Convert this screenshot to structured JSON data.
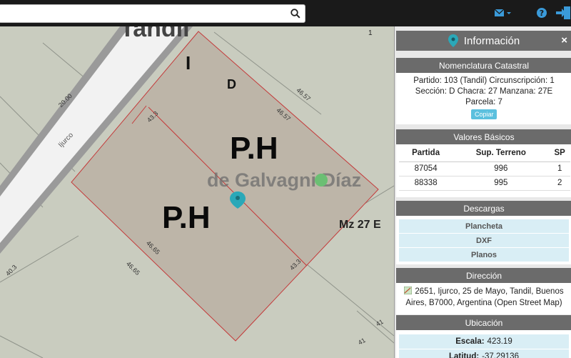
{
  "search": {
    "value": "",
    "placeholder": ""
  },
  "toolbar": {
    "mail_icon": "envelope-icon",
    "help_icon": "question-icon",
    "exit_icon": "sign-out-icon"
  },
  "map": {
    "city_label": "Tandil",
    "street_label": "Ijurco",
    "parcel_letter": "I",
    "sub_letter": "D",
    "ph_upper": "P.H",
    "ph_lower": "P.H",
    "block_label": "Mz 27 E",
    "corner_number": "1",
    "watermark": "de Galvagni Díaz",
    "dims": {
      "street_width": "20.00",
      "left_top_side": "40.3",
      "upper_front": "43.3",
      "upper_back": "46.57",
      "upper_back_outer": "46.57",
      "lower_side": "46.65",
      "lower_side_outer": "46.65",
      "lower_front": "43.3",
      "corner_41a": "41",
      "corner_41b": "41"
    },
    "colors": {
      "parcel": "#bdb5a8",
      "parcel_line": "#c43a3a",
      "road": "#f2f2f2",
      "road_edge": "#8a8a8a",
      "marker": "#2aa8b8"
    }
  },
  "panel": {
    "title": "Información",
    "close": "×",
    "nomenclatura": {
      "title": "Nomenclatura Catastral",
      "text": "Partido: 103 (Tandil) Circunscripción: 1 Sección: D Chacra: 27 Manzana: 27E Parcela: 7",
      "copy_label": "Copiar"
    },
    "valores": {
      "title": "Valores Básicos",
      "headers": [
        "Partida",
        "Sup. Terreno",
        "SP"
      ],
      "rows": [
        [
          "87054",
          "996",
          "1"
        ],
        [
          "88338",
          "995",
          "2"
        ]
      ]
    },
    "descargas": {
      "title": "Descargas",
      "items": [
        "Plancheta",
        "DXF",
        "Planos"
      ]
    },
    "direccion": {
      "title": "Dirección",
      "text": "2651, Ijurco, 25 de Mayo, Tandil, Buenos Aires, B7000, Argentina (Open Street Map)"
    },
    "ubicacion": {
      "title": "Ubicación",
      "escala_label": "Escala:",
      "escala_value": "423.19",
      "latitud_label": "Latitud:",
      "latitud_value": "-37.29136"
    }
  }
}
